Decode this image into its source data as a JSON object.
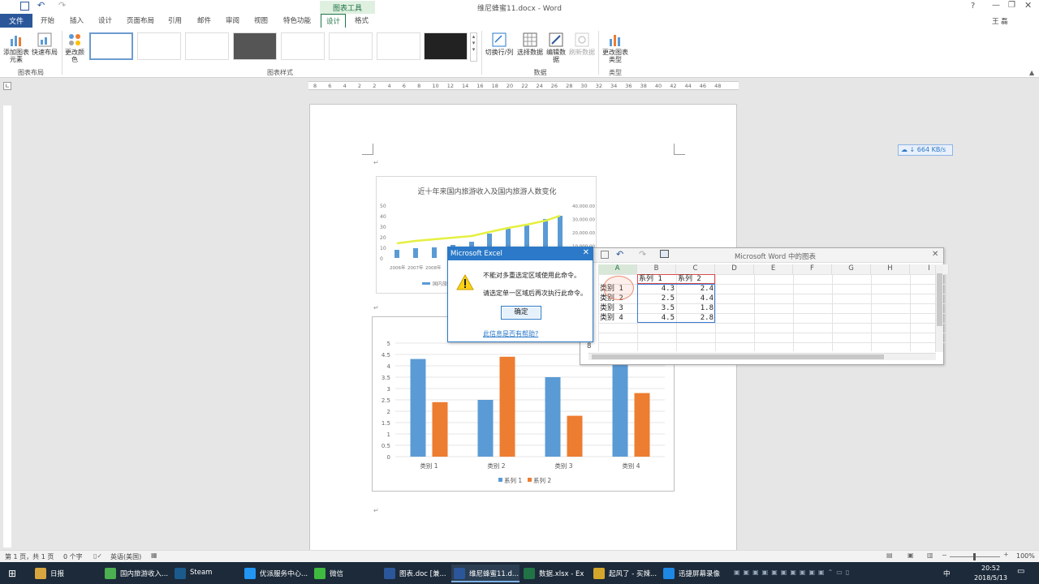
{
  "window": {
    "title": "维尼蜂蜜11.docx - Word",
    "context_group": "图表工具",
    "user": "王 磊"
  },
  "tabs": [
    "文件",
    "开始",
    "插入",
    "设计",
    "页面布局",
    "引用",
    "邮件",
    "审阅",
    "视图",
    "特色功能",
    "设计",
    "格式"
  ],
  "ribbon": {
    "add_element": "添加图表元素",
    "quick_layout": "快速布局",
    "change_colors": "更改颜色",
    "switch_row_col": "切换行/列",
    "select_data": "选择数据",
    "edit_data": "编辑数据",
    "refresh_data": "刷新数据",
    "change_type": "更改图表类型",
    "group_layout": "图表布局",
    "group_styles": "图表样式",
    "group_data": "数据",
    "group_type": "类型"
  },
  "ruler_ticks": [
    "8",
    "6",
    "4",
    "2",
    "2",
    "4",
    "6",
    "8",
    "10",
    "12",
    "14",
    "16",
    "18",
    "20",
    "22",
    "24",
    "26",
    "28",
    "30",
    "32",
    "34",
    "36",
    "38",
    "40",
    "42",
    "44",
    "46",
    "48"
  ],
  "chart1": {
    "title": "近十年来国内旅游收入及国内旅游人数变化",
    "left_ticks": [
      "50",
      "40",
      "30",
      "20",
      "10",
      "0"
    ],
    "right_ticks": [
      "40,000.00",
      "30,000.00",
      "20,000.00",
      "10,000.00"
    ],
    "x_labels": [
      "2006年",
      "2007年",
      "2008年"
    ],
    "legend": "国内旅"
  },
  "chart_data": {
    "type": "bar",
    "categories": [
      "类别 1",
      "类别 2",
      "类别 3",
      "类别 4"
    ],
    "series": [
      {
        "name": "系列 1",
        "values": [
          4.3,
          2.5,
          3.5,
          4.5
        ],
        "color": "#5b9bd5"
      },
      {
        "name": "系列 2",
        "values": [
          2.4,
          4.4,
          1.8,
          2.8
        ],
        "color": "#ed7d31"
      }
    ],
    "ylim": [
      0,
      5
    ],
    "yticks": [
      "0",
      "0.5",
      "1",
      "1.5",
      "2",
      "2.5",
      "3",
      "3.5",
      "4",
      "4.5",
      "5"
    ],
    "grid": true,
    "legend_position": "bottom"
  },
  "dialog": {
    "title": "Microsoft Excel",
    "line1": "不能对多重选定区域使用此命令。",
    "line2": "请选定单一区域后再次执行此命令。",
    "ok": "确定",
    "help": "此信息是否有帮助?"
  },
  "excel": {
    "title": "Microsoft Word 中的图表",
    "columns": [
      "A",
      "B",
      "C",
      "D",
      "E",
      "F",
      "G",
      "H",
      "I"
    ],
    "header_row": [
      "",
      "系列 1",
      "系列 2"
    ],
    "rows": [
      [
        "类别 1",
        "4.3",
        "2.4"
      ],
      [
        "类别 2",
        "2.5",
        "4.4"
      ],
      [
        "类别 3",
        "3.5",
        "1.8"
      ],
      [
        "类别 4",
        "4.5",
        "2.8"
      ]
    ],
    "row_label": "8"
  },
  "netspeed": "664 KB/s",
  "status": {
    "page": "第 1 页，共 1 页",
    "words": "0 个字",
    "lang": "英语(美国)",
    "zoom": "100%"
  },
  "taskbar": {
    "items": [
      {
        "label": "日报",
        "color": "#d9a53f"
      },
      {
        "label": "国内旅游收入...",
        "color": "#4caf50"
      },
      {
        "label": "Steam",
        "color": "#1b5a8c"
      },
      {
        "label": "优派服务中心...",
        "color": "#2196f3"
      },
      {
        "label": "微信",
        "color": "#3fb83f"
      },
      {
        "label": "图表.doc [兼...",
        "color": "#2b579a"
      },
      {
        "label": "维尼蜂蜜11.d...",
        "color": "#2b579a"
      },
      {
        "label": "数据.xlsx - Ex",
        "color": "#217346"
      },
      {
        "label": "起风了 - 买辣...",
        "color": "#d4a72c"
      },
      {
        "label": "迅捷屏幕录像",
        "color": "#1e88e5"
      }
    ],
    "time": "20:52",
    "date": "2018/5/13",
    "ime": "中"
  }
}
